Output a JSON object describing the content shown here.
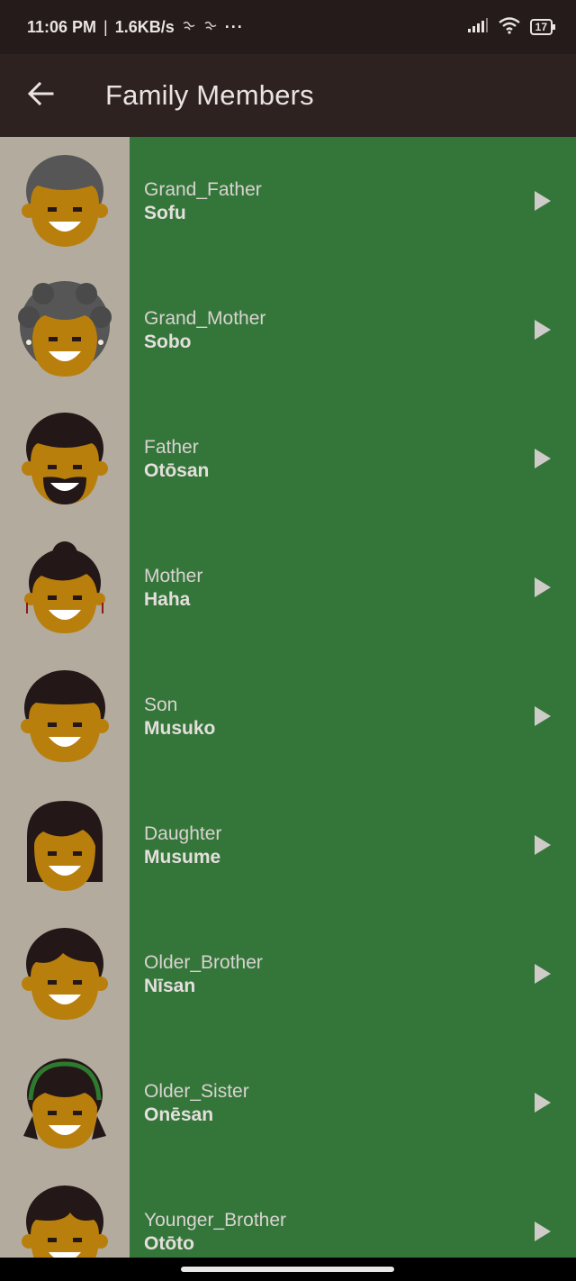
{
  "status_bar": {
    "time": "11:06 PM",
    "separator": "|",
    "speed": "1.6KB/s",
    "more": "···",
    "battery": "17"
  },
  "app_bar": {
    "back_icon": "arrow-left-icon",
    "title": "Family Members"
  },
  "colors": {
    "status_bar_bg": "#241b1a",
    "app_bar_bg": "#2e2220",
    "list_bg": "#34763a",
    "avatar_column_bg": "#b2ab9e",
    "skin": "#b97f0c",
    "hair_dark": "#231717",
    "hair_gray": "#565656"
  },
  "members": [
    {
      "english": "Grand_Father",
      "japanese": "Sofu",
      "avatar": "grandfather-avatar"
    },
    {
      "english": "Grand_Mother",
      "japanese": "Sobo",
      "avatar": "grandmother-avatar"
    },
    {
      "english": "Father",
      "japanese": "Otōsan",
      "avatar": "father-avatar"
    },
    {
      "english": "Mother",
      "japanese": "Haha",
      "avatar": "mother-avatar"
    },
    {
      "english": "Son",
      "japanese": "Musuko",
      "avatar": "son-avatar"
    },
    {
      "english": "Daughter",
      "japanese": "Musume",
      "avatar": "daughter-avatar"
    },
    {
      "english": "Older_Brother",
      "japanese": "Nīsan",
      "avatar": "older-brother-avatar"
    },
    {
      "english": "Older_Sister",
      "japanese": "Onēsan",
      "avatar": "older-sister-avatar"
    },
    {
      "english": "Younger_Brother",
      "japanese": "Otōto",
      "avatar": "younger-brother-avatar"
    }
  ]
}
